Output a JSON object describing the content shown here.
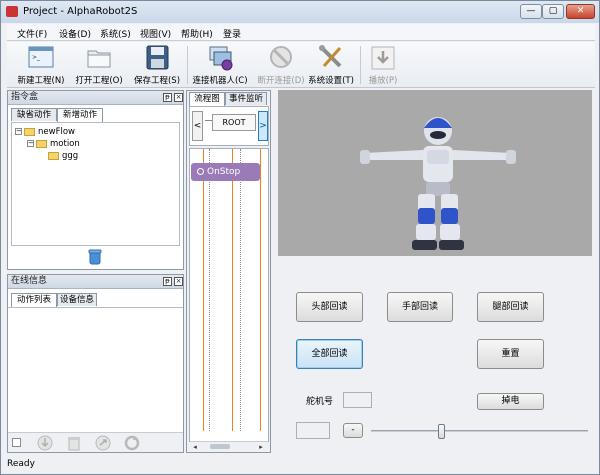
{
  "window": {
    "title": "Project - AlphaRobot2S",
    "minimize": "—",
    "restore": "▢",
    "close": "✕"
  },
  "menu": [
    "文件(F)",
    "设备(D)",
    "系统(S)",
    "视图(V)",
    "帮助(H)",
    "登录"
  ],
  "toolbar": {
    "new_project": "新建工程(N)",
    "open_project": "打开工程(O)",
    "save_project": "保存工程(S)",
    "connect_robot": "连接机器人(C)",
    "disconnect": "断开连接(D)",
    "settings": "系统设置(T)",
    "play": "播放(P)"
  },
  "command_box": {
    "title": "指令盒",
    "tabs": [
      "缺省动作",
      "新增动作"
    ],
    "tree": [
      "newFlow",
      "motion",
      "ggg"
    ]
  },
  "online_info": {
    "title": "在线信息",
    "tabs": [
      "动作列表",
      "设备信息"
    ]
  },
  "flow": {
    "tabs": [
      "流程图",
      "事件监听"
    ],
    "root_label": "ROOT",
    "prev": "<",
    "next": ">",
    "node_label": "OnStop"
  },
  "controls": {
    "head_readback": "头部回读",
    "hand_readback": "手部回读",
    "leg_readback": "腿部回读",
    "all_readback": "全部回读",
    "reset": "重置",
    "servo_label": "舵机号",
    "power_off": "掉电",
    "minus": "-",
    "slider_value": 0.5
  },
  "status": {
    "text": "Ready"
  },
  "colors": {
    "node": "#9b7ab8",
    "guide_line": "#f08020"
  }
}
